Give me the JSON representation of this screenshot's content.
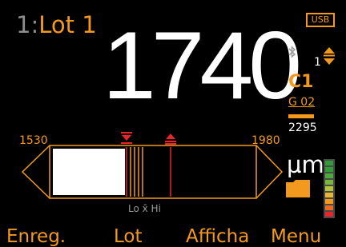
{
  "header": {
    "lot_number": "1:",
    "lot_name": "Lot 1",
    "usb_label": "USB"
  },
  "measurement": {
    "reading": "1740",
    "unit": "µm",
    "calibration": "C1",
    "group": "G 02",
    "sort_index": "1",
    "count_or_limit": "2295"
  },
  "scale": {
    "min": "1530",
    "max": "1980",
    "lo_hi_label": "Lo x̄ Hi"
  },
  "softkeys": [
    {
      "label": "Enreg."
    },
    {
      "label": "Lot"
    },
    {
      "label": "Afficha"
    },
    {
      "label": "Menu"
    }
  ],
  "icons": {
    "bluetooth": "bluetooth-icon",
    "sort": "sort-icon",
    "folder": "folder-icon",
    "signal": "signal-level-icon",
    "low_limit": "low-limit-marker-icon",
    "high_limit": "high-limit-marker-icon"
  },
  "colors": {
    "accent": "#f39a1e",
    "reading": "#ffffff",
    "limit_red": "#e8262a",
    "background": "#000000"
  }
}
